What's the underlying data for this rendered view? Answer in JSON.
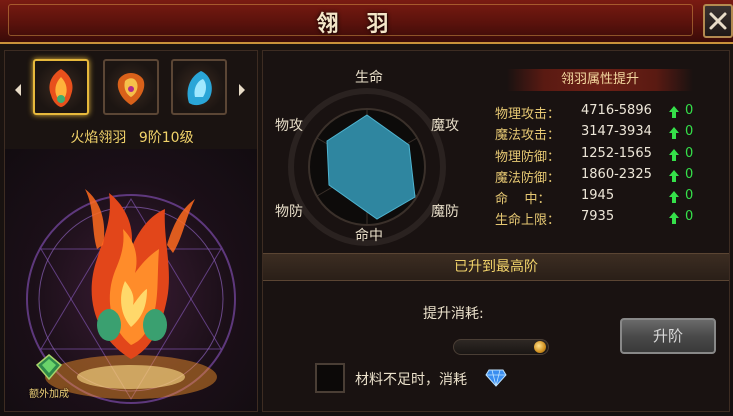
{
  "title": "翎羽",
  "wings": {
    "slots": [
      {
        "icon": "flame-wing-icon",
        "selected": true
      },
      {
        "icon": "orange-wing-icon",
        "selected": false
      },
      {
        "icon": "blue-wing-icon",
        "selected": false
      }
    ],
    "selected_name": "火焰翎羽",
    "selected_stage": "9阶10级",
    "extra_bonus_label": "额外加成"
  },
  "radar": {
    "labels": {
      "top": "生命",
      "upper_left": "物攻",
      "upper_right": "魔攻",
      "lower_left": "物防",
      "lower_right": "魔防",
      "bottom": "命中"
    },
    "fill_color": "#2f86a0"
  },
  "attributes": {
    "header": "翎羽属性提升",
    "rows": [
      {
        "name": "物理攻击：",
        "value": "4716-5896",
        "increase": "0"
      },
      {
        "name": "魔法攻击：",
        "value": "3147-3934",
        "increase": "0"
      },
      {
        "name": "物理防御：",
        "value": "1252-1565",
        "increase": "0"
      },
      {
        "name": "魔法防御：",
        "value": "1860-2325",
        "increase": "0"
      },
      {
        "name": "命    中：",
        "value": "1945",
        "increase": "0"
      },
      {
        "name": "生命上限：",
        "value": "7935",
        "increase": "0"
      }
    ],
    "increase_color": "#35e04a"
  },
  "upgrade": {
    "status": "已升到最高阶",
    "cost_label": "提升消耗:",
    "button_label": "升阶",
    "auto_label": "材料不足时，消耗"
  }
}
